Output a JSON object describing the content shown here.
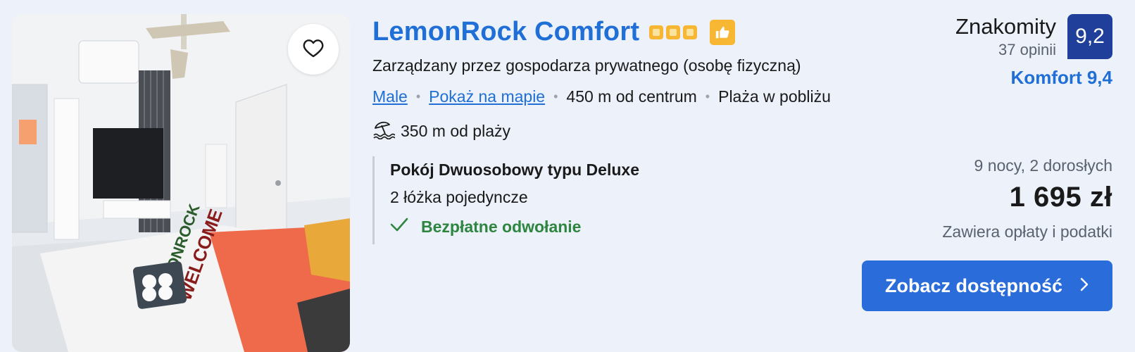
{
  "property": {
    "name": "LemonRock Comfort",
    "stars": 3,
    "managed_by": "Zarządzany przez gospodarza prywatnego (osobę fizyczną)",
    "location_link": "Male",
    "map_link": "Pokaż na mapie",
    "distance_center": "450 m od centrum",
    "beach_nearby": "Plaża w pobliżu",
    "beach_distance": "350 m od plaży",
    "icons": {
      "favorite": "heart-icon",
      "stars": "star-square-icon",
      "preferred": "thumbs-up-icon",
      "beach": "beach-umbrella-icon",
      "check": "check-icon",
      "chevron": "chevron-right-icon"
    }
  },
  "rating": {
    "label": "Znakomity",
    "reviews": "37 opinii",
    "score": "9,2",
    "comfort": "Komfort 9,4"
  },
  "room": {
    "name": "Pokój Dwuosobowy typu Deluxe",
    "beds": "2 łóżka pojedyncze",
    "cancellation": "Bezpłatne odwołanie"
  },
  "pricing": {
    "stay": "9 nocy, 2 dorosłych",
    "price": "1 695 zł",
    "taxes": "Zawiera opłaty i podatki"
  },
  "cta": {
    "label": "Zobacz dostępność"
  },
  "colors": {
    "link": "#1f6fd6",
    "score_bg": "#1f3f9a",
    "cta_bg": "#2a6cd9",
    "star": "#f7b733",
    "success": "#2e8540",
    "page_bg": "#ecf1fa"
  }
}
